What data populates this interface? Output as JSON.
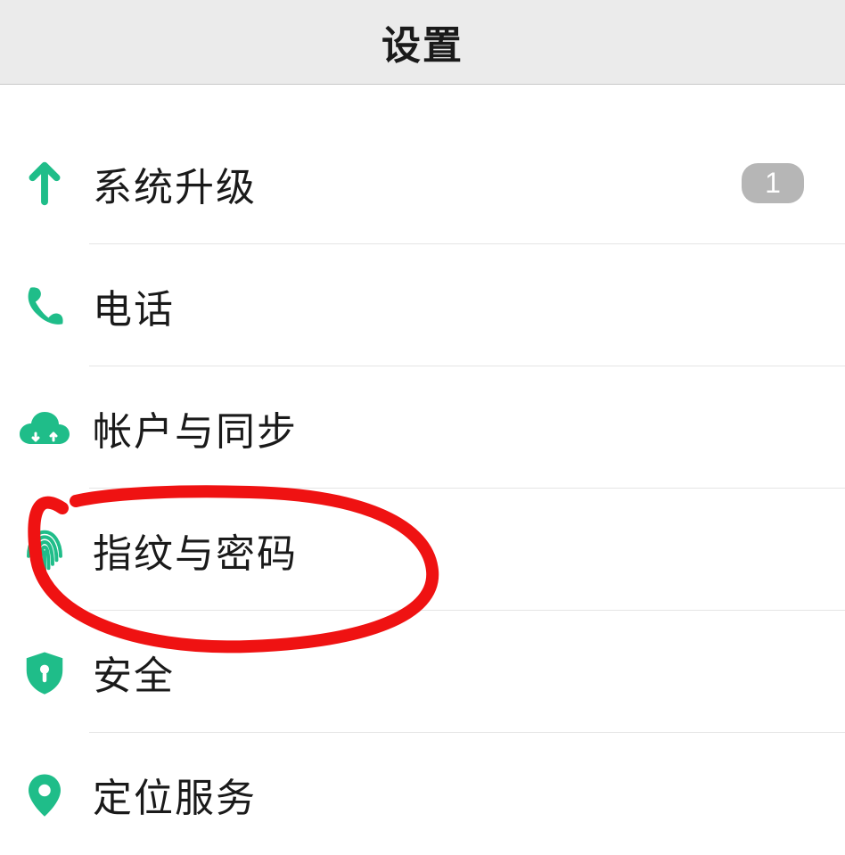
{
  "header": {
    "title": "设置"
  },
  "items": [
    {
      "label": "系统升级",
      "badge": "1",
      "icon": "arrow-up"
    },
    {
      "label": "电话",
      "badge": null,
      "icon": "phone"
    },
    {
      "label": "帐户与同步",
      "badge": null,
      "icon": "cloud-sync"
    },
    {
      "label": "指纹与密码",
      "badge": null,
      "icon": "fingerprint"
    },
    {
      "label": "安全",
      "badge": null,
      "icon": "shield"
    },
    {
      "label": "定位服务",
      "badge": null,
      "icon": "location"
    }
  ],
  "colors": {
    "accent": "#1fbd89",
    "badge_bg": "#b6b6b6"
  }
}
